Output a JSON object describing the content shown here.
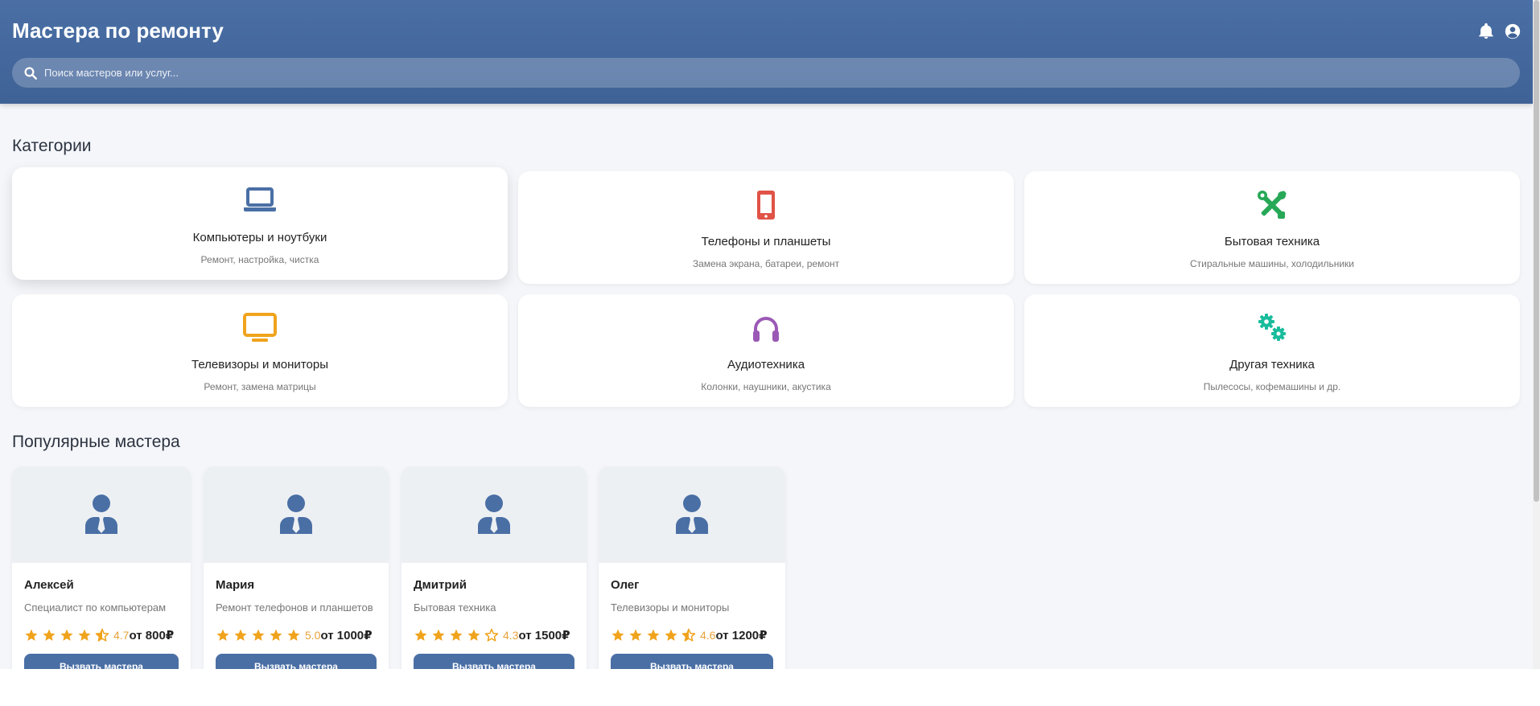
{
  "header": {
    "title": "Мастера по ремонту",
    "bell_icon": "bell-icon",
    "user_icon": "user-circle-icon"
  },
  "search": {
    "placeholder": "Поиск мастеров или услуг...",
    "value": "",
    "icon": "search-icon"
  },
  "categories": {
    "title": "Категории",
    "items": [
      {
        "name": "Компьютеры и ноутбуки",
        "desc": "Ремонт, настройка, чистка",
        "icon": "laptop-icon",
        "color": "#4a6fa5"
      },
      {
        "name": "Телефоны и планшеты",
        "desc": "Замена экрана, батареи, ремонт",
        "icon": "mobile-phone-icon",
        "color": "#e05346"
      },
      {
        "name": "Бытовая техника",
        "desc": "Стиральные машины, холодильники",
        "icon": "tools-icon",
        "color": "#27a857"
      },
      {
        "name": "Телевизоры и мониторы",
        "desc": "Ремонт, замена матрицы",
        "icon": "tv-icon",
        "color": "#f0a31c"
      },
      {
        "name": "Аудиотехника",
        "desc": "Колонки, наушники, акустика",
        "icon": "headphones-icon",
        "color": "#9b59b6"
      },
      {
        "name": "Другая техника",
        "desc": "Пылесосы, кофемашины и др.",
        "icon": "cogs-icon",
        "color": "#1abc9c"
      }
    ]
  },
  "masters": {
    "title": "Популярные мастера",
    "button_label": "Вызвать мастера",
    "items": [
      {
        "name": "Алексей",
        "specialty": "Специалист по компьютерам",
        "rating": "4.7",
        "price": "от 800₽",
        "icon": "user-tie-icon"
      },
      {
        "name": "Мария",
        "specialty": "Ремонт телефонов и планшетов",
        "rating": "5.0",
        "price": "от 1000₽",
        "icon": "user-tie-icon"
      },
      {
        "name": "Дмитрий",
        "specialty": "Бытовая техника",
        "rating": "4.3",
        "price": "от 1500₽",
        "icon": "user-tie-icon"
      },
      {
        "name": "Олег",
        "specialty": "Телевизоры и мониторы",
        "rating": "4.6",
        "price": "от 1200₽",
        "icon": "user-tie-icon"
      }
    ]
  },
  "colors": {
    "primary": "#4a6fa5",
    "star": "#f0a31c",
    "background": "#f4f6fa"
  }
}
